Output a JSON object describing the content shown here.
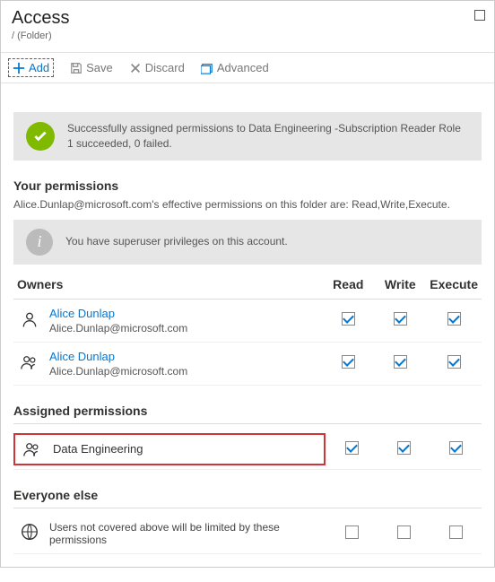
{
  "header": {
    "title": "Access",
    "breadcrumb": "/ (Folder)"
  },
  "toolbar": {
    "add": "Add",
    "save": "Save",
    "discard": "Discard",
    "advanced": "Advanced"
  },
  "success_banner": {
    "line1": "Successfully assigned permissions to Data Engineering -Subscription Reader Role",
    "line2": "1 succeeded, 0 failed."
  },
  "your_permissions": {
    "title": "Your permissions",
    "description": "Alice.Dunlap@microsoft.com's effective permissions on this folder are: Read,Write,Execute.",
    "info_banner": "You have superuser privileges on this account."
  },
  "columns": {
    "owners": "Owners",
    "read": "Read",
    "write": "Write",
    "execute": "Execute"
  },
  "owners": [
    {
      "name": "Alice Dunlap",
      "email": "Alice.Dunlap@microsoft.com",
      "type": "user",
      "read": true,
      "write": true,
      "execute": true
    },
    {
      "name": "Alice Dunlap",
      "email": "Alice.Dunlap@microsoft.com",
      "type": "group",
      "read": true,
      "write": true,
      "execute": true
    }
  ],
  "assigned": {
    "title": "Assigned permissions",
    "items": [
      {
        "name": "Data Engineering",
        "type": "group",
        "read": true,
        "write": true,
        "execute": true,
        "highlighted": true
      }
    ]
  },
  "everyone": {
    "title": "Everyone else",
    "description": "Users not covered above will be limited by these permissions",
    "read": false,
    "write": false,
    "execute": false
  }
}
